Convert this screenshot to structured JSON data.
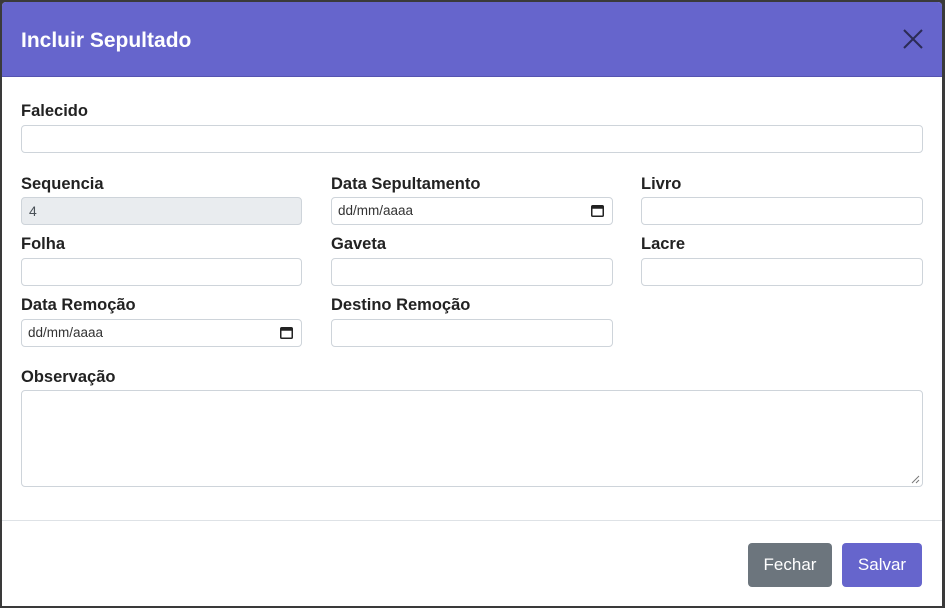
{
  "modal": {
    "title": "Incluir Sepultado"
  },
  "form": {
    "falecido_label": "Falecido",
    "falecido_value": "",
    "sequencia_label": "Sequencia",
    "sequencia_value": "4",
    "data_sepultamento_label": "Data Sepultamento",
    "data_sepultamento_value": "dd/mm/aaaa",
    "livro_label": "Livro",
    "livro_value": "",
    "folha_label": "Folha",
    "folha_value": "",
    "gaveta_label": "Gaveta",
    "gaveta_value": "",
    "lacre_label": "Lacre",
    "lacre_value": "",
    "data_remocao_label": "Data Remoção",
    "data_remocao_value": "dd/mm/aaaa",
    "destino_remocao_label": "Destino Remoção",
    "destino_remocao_value": "",
    "observacao_label": "Observação",
    "observacao_value": ""
  },
  "footer": {
    "close_label": "Fechar",
    "save_label": "Salvar"
  },
  "colors": {
    "header": "#6665cc",
    "save_button": "#6665cc",
    "close_button": "#6c757d"
  },
  "icons": {
    "close": "close-icon",
    "calendar": "calendar-icon",
    "resize": "resize-handle-icon"
  }
}
